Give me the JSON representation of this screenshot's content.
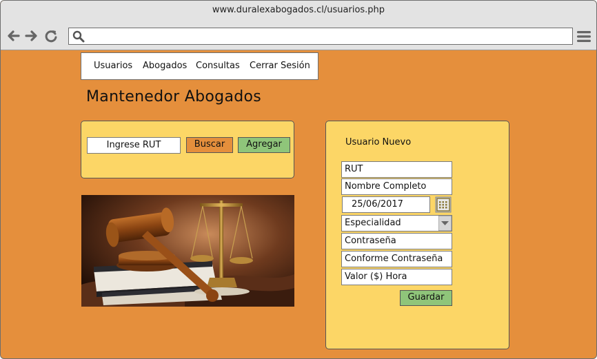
{
  "browser": {
    "url": "www.duralexabogados.cl/usuarios.php",
    "address_value": "",
    "icons": [
      "back-arrow-icon",
      "forward-arrow-icon",
      "reload-icon",
      "search-icon",
      "hamburger-menu-icon"
    ]
  },
  "nav": {
    "items": [
      {
        "label": "Usuarios"
      },
      {
        "label": "Abogados"
      },
      {
        "label": "Consultas"
      },
      {
        "label": "Cerrar Sesión"
      }
    ]
  },
  "page": {
    "title": "Mantenedor Abogados"
  },
  "search_panel": {
    "rut_placeholder": "Ingrese RUT",
    "buscar_label": "Buscar",
    "agregar_label": "Agregar"
  },
  "form": {
    "title": "Usuario Nuevo",
    "rut_placeholder": "RUT",
    "nombre_placeholder": "Nombre Completo",
    "fecha_value": "25/06/2017",
    "especialidad_value": "Especialidad",
    "contrasena_placeholder": "Contraseña",
    "conforme_placeholder": "Conforme Contraseña",
    "valor_placeholder": "Valor ($) Hora",
    "guardar_label": "Guardar"
  },
  "colors": {
    "background": "#e58f3c",
    "panel": "#fcd666",
    "buscar": "#e58f3c",
    "agregar_guardar": "#8fc57a"
  }
}
